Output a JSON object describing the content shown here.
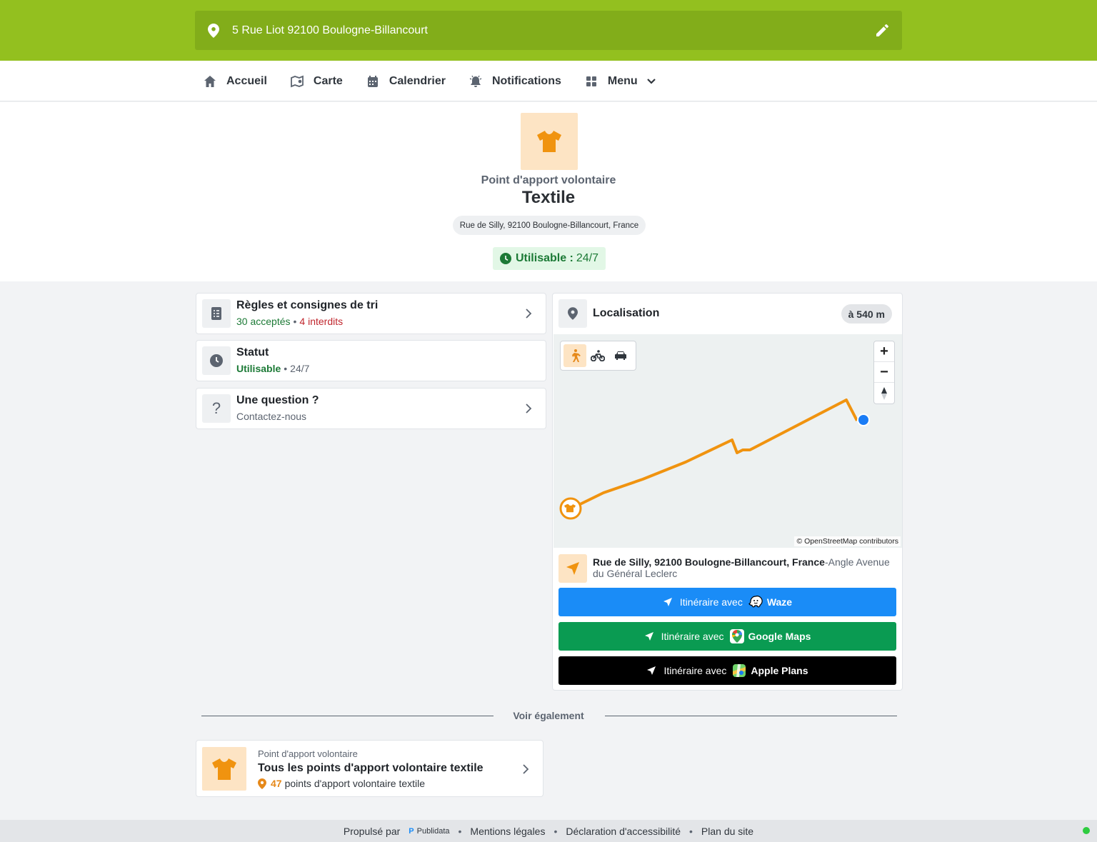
{
  "header": {
    "address": "5 Rue Liot 92100 Boulogne-Billancourt",
    "brand_color": "#93c01f"
  },
  "nav": {
    "items": [
      {
        "label": "Accueil",
        "icon": "home-icon"
      },
      {
        "label": "Carte",
        "icon": "map-icon"
      },
      {
        "label": "Calendrier",
        "icon": "calendar-icon"
      },
      {
        "label": "Notifications",
        "icon": "bell-icon"
      },
      {
        "label": "Menu",
        "icon": "grid-icon"
      }
    ]
  },
  "hero": {
    "subtitle": "Point d'apport volontaire",
    "title": "Textile",
    "address": "Rue de Silly, 92100 Boulogne-Billancourt, France",
    "status_label": "Utilisable :",
    "status_value": "24/7"
  },
  "cards": {
    "rules": {
      "title": "Règles et consignes de tri",
      "accepted_count": "30",
      "accepted_label": "acceptés",
      "forbidden_count": "4",
      "forbidden_label": "interdits"
    },
    "status": {
      "title": "Statut",
      "state": "Utilisable",
      "hours": "24/7"
    },
    "question": {
      "title": "Une question ?",
      "subtitle": "Contactez-nous"
    }
  },
  "location": {
    "title": "Localisation",
    "distance": "à 540 m",
    "map_attribution": "© OpenStreetMap contributors",
    "zoom_in": "+",
    "zoom_out": "−",
    "address_bold": "Rue de Silly, 92100 Boulogne-Billancourt, France",
    "address_detail": "-Angle Avenue du Général Leclerc",
    "route_color": "#f0930f",
    "buttons": [
      {
        "prefix": "Itinéraire avec",
        "app": "Waze",
        "color": "#1a8cf7"
      },
      {
        "prefix": "Itinéraire avec",
        "app": "Google Maps",
        "color": "#0a9b52"
      },
      {
        "prefix": "Itinéraire avec",
        "app": "Apple Plans",
        "color": "#000000"
      }
    ]
  },
  "see_also": {
    "heading": "Voir également",
    "item": {
      "kicker": "Point d'apport volontaire",
      "title": "Tous les points d'apport volontaire textile",
      "count": "47",
      "count_label": "points d'apport volontaire textile"
    }
  },
  "footer": {
    "powered_by": "Propulsé par",
    "provider": "Publidata",
    "links": [
      "Mentions légales",
      "Déclaration d'accessibilité",
      "Plan du site"
    ]
  }
}
